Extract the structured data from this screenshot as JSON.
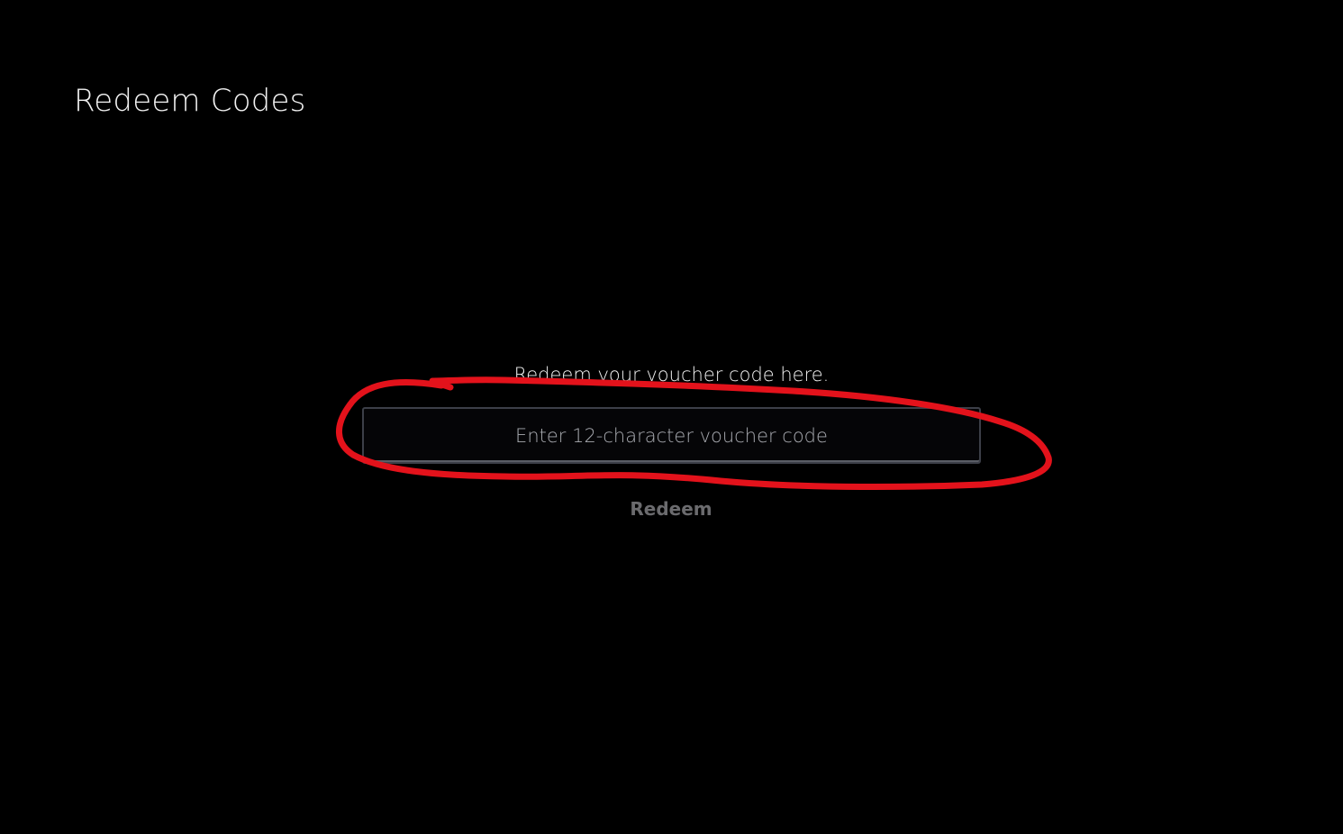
{
  "page": {
    "title": "Redeem Codes"
  },
  "redeem": {
    "instruction": "Redeem your voucher code here.",
    "code_placeholder": "Enter 12-character voucher code",
    "button_label": "Redeem"
  },
  "colors": {
    "background": "#000000",
    "annotation": "#e3121b"
  }
}
